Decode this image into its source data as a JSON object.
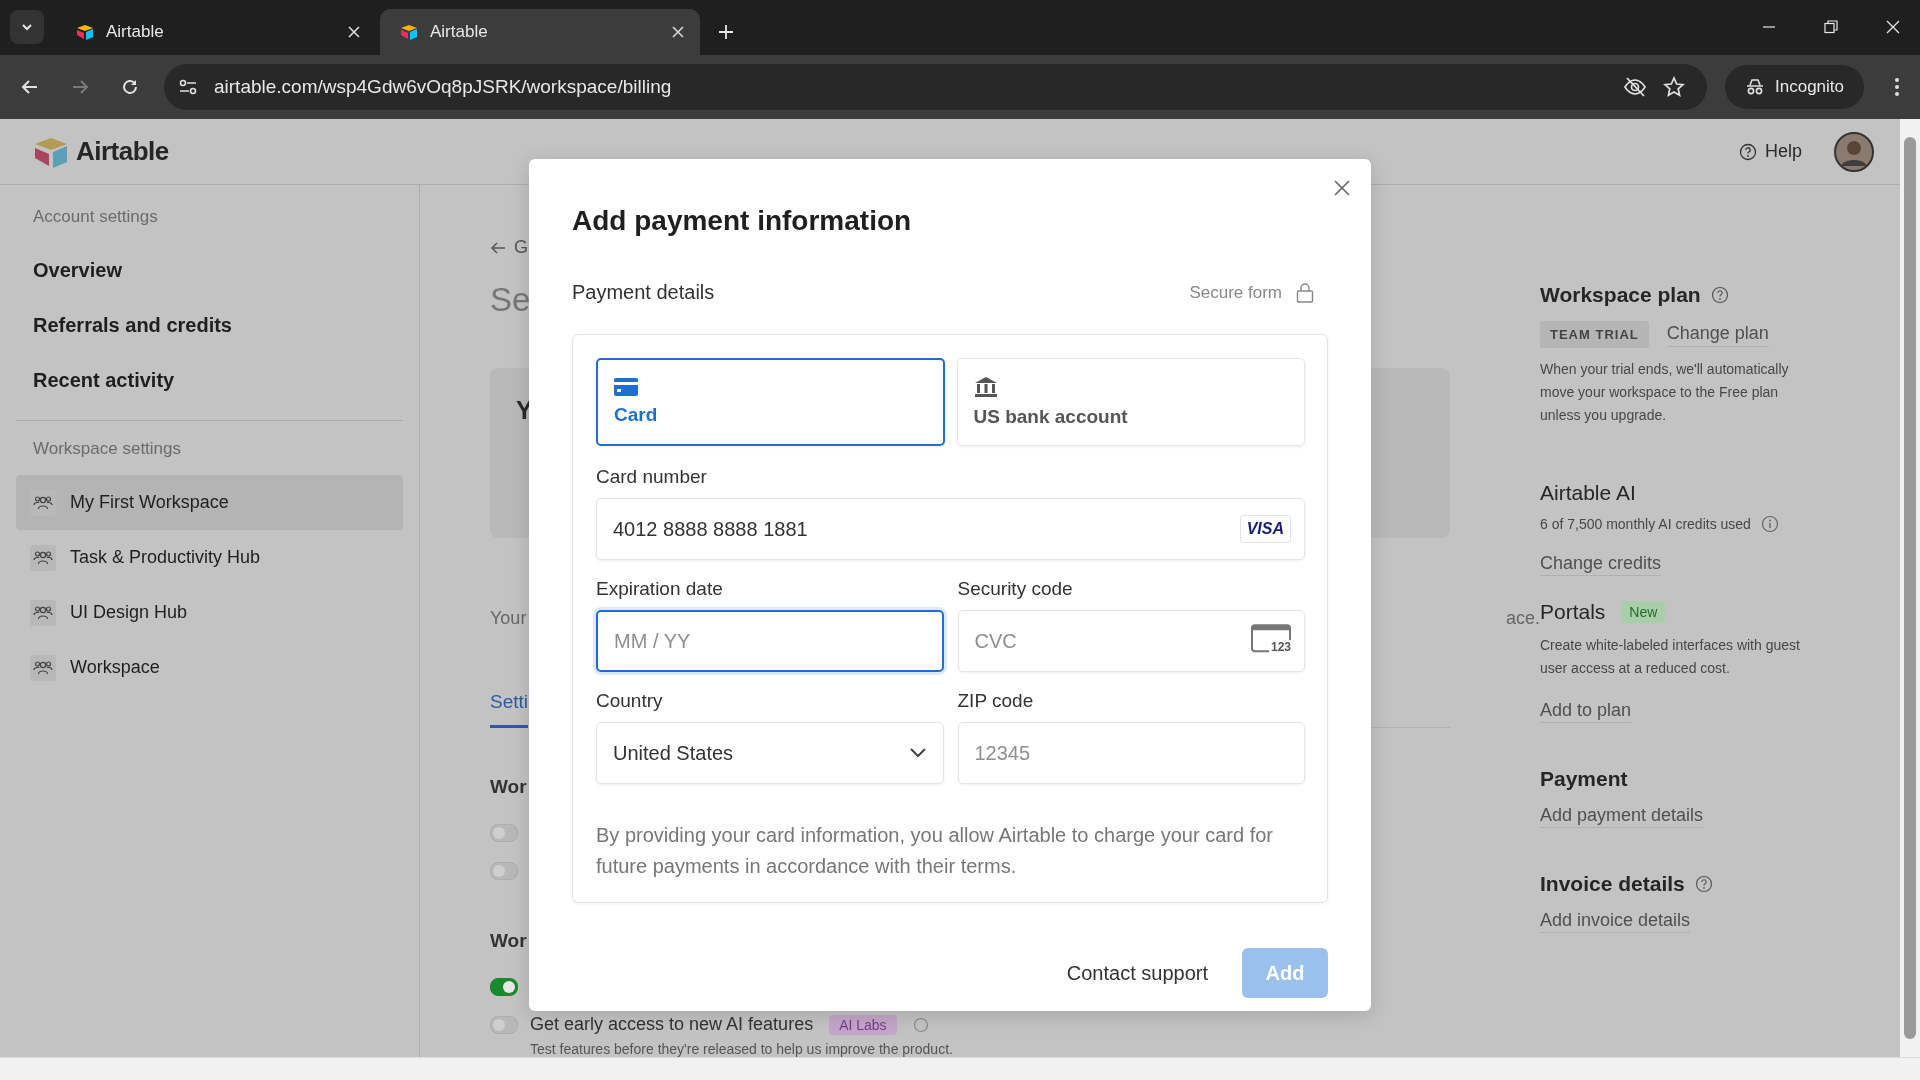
{
  "browser": {
    "tabs": [
      {
        "title": "Airtable",
        "selected": false
      },
      {
        "title": "Airtable",
        "selected": true
      }
    ],
    "url": "airtable.com/wsp4Gdw6vOq8pJSRK/workspace/billing",
    "profile": "Incognito"
  },
  "app": {
    "logo": "Airtable",
    "help": "Help"
  },
  "sidebar": {
    "sections": [
      {
        "title": "Account settings",
        "kind": "account",
        "items": [
          {
            "label": "Overview",
            "selected": false
          },
          {
            "label": "Referrals and credits",
            "selected": false
          },
          {
            "label": "Recent activity",
            "selected": false
          }
        ]
      },
      {
        "title": "Workspace settings",
        "kind": "workspace",
        "items": [
          {
            "label": "My First Workspace",
            "selected": true
          },
          {
            "label": "Task & Productivity Hub",
            "selected": false
          },
          {
            "label": "UI Design Hub",
            "selected": false
          },
          {
            "label": "Workspace",
            "selected": false
          }
        ]
      }
    ]
  },
  "main": {
    "back_link": "G",
    "heading": "Se",
    "card_title": "Y",
    "note_start": "Your",
    "note_end": "ace.",
    "tab": {
      "label": "Setti",
      "selected": true
    },
    "sections": [
      {
        "heading": "Wor",
        "toggles": [
          {
            "on": false
          },
          {
            "on": false
          }
        ]
      },
      {
        "heading": "Wor",
        "toggles": [
          {
            "on": true
          },
          {
            "on": false,
            "label": "Get early access to new AI features",
            "badge": "AI Labs",
            "description": "Test features before they're released to help us improve the product."
          }
        ]
      }
    ]
  },
  "right_panel": {
    "plan": {
      "title": "Workspace plan",
      "badge": "TEAM TRIAL",
      "link": "Change plan",
      "description": "When your trial ends, we'll automatically move your workspace to the Free plan unless you upgrade."
    },
    "ai": {
      "title": "Airtable AI",
      "usage": "6 of 7,500 monthly AI credits used",
      "link": "Change credits"
    },
    "portals": {
      "title": "Portals",
      "badge": "New",
      "description": "Create white-labeled interfaces with guest user access at a reduced cost.",
      "link": "Add to plan"
    },
    "payment": {
      "title": "Payment",
      "link": "Add payment details"
    },
    "invoice": {
      "title": "Invoice details",
      "link": "Add invoice details"
    }
  },
  "dialog": {
    "title": "Add payment information",
    "section": "Payment details",
    "secure_label": "Secure form",
    "methods": [
      {
        "label": "Card",
        "kind": "card",
        "selected": true
      },
      {
        "label": "US bank account",
        "kind": "bank",
        "selected": false
      }
    ],
    "fields": [
      {
        "label": "Card number",
        "kind": "card-number",
        "value": "4012 8888 8888 1881",
        "badge": "VISA",
        "focused": false
      },
      {
        "label": "Expiration date",
        "kind": "expiry",
        "placeholder": "MM / YY",
        "focused": true
      },
      {
        "label": "Security code",
        "kind": "cvc",
        "placeholder": "CVC",
        "badge": "123",
        "focused": false
      },
      {
        "label": "Country",
        "kind": "select",
        "value": "United States",
        "focused": false
      },
      {
        "label": "ZIP code",
        "kind": "zip",
        "placeholder": "12345",
        "focused": false
      }
    ],
    "consent": "By providing your card information, you allow Airtable to charge your card for future payments in accordance with their terms.",
    "buttons": [
      {
        "label": "Contact support",
        "kind": "text",
        "disabled": false
      },
      {
        "label": "Add",
        "kind": "primary",
        "disabled": true
      }
    ]
  }
}
